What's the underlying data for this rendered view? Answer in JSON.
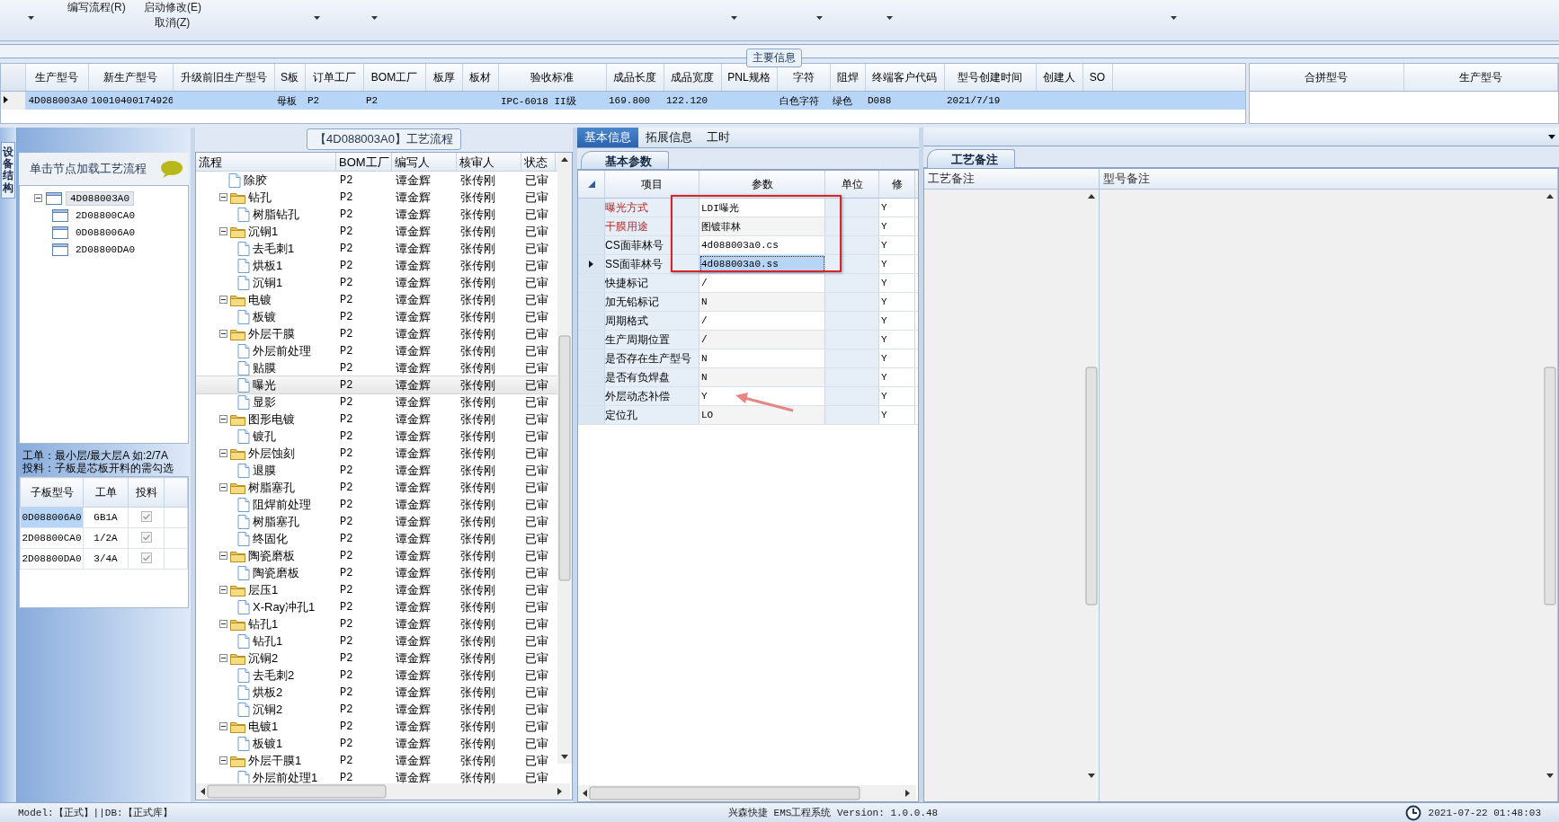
{
  "toolbar": {
    "commands": [
      {
        "label": "编写流程(R)"
      },
      {
        "label": "启动修改(E)"
      },
      {
        "label": "取消(Z)"
      }
    ]
  },
  "main_info": {
    "title": "主要信息",
    "row_selected": true,
    "columns": [
      {
        "label": "生产型号",
        "value": "4D088003A0"
      },
      {
        "label": "新生产型号",
        "value": "10010400174926"
      },
      {
        "label": "升级前旧生产型号"
      },
      {
        "label": "S板",
        "value": "母板"
      },
      {
        "label": "订单工厂",
        "value": "P2"
      },
      {
        "label": "BOM工厂",
        "value": "P2"
      },
      {
        "label": "板厚"
      },
      {
        "label": "板材"
      },
      {
        "label": "验收标准",
        "value": "IPC-6018 II级"
      },
      {
        "label": "成品长度",
        "value": "169.800"
      },
      {
        "label": "成品宽度",
        "value": "122.120"
      },
      {
        "label": "PNL规格"
      },
      {
        "label": "字符",
        "value": "白色字符"
      },
      {
        "label": "阻焊",
        "value": "绿色"
      },
      {
        "label": "终端客户代码",
        "value": "D088"
      },
      {
        "label": "型号创建时间",
        "value": "2021/7/19"
      },
      {
        "label": "创建人"
      },
      {
        "label": "SO"
      }
    ],
    "merge_columns": [
      "合拼型号",
      "生产型号"
    ]
  },
  "structure": {
    "tab": "设备结构",
    "hint": "单击节点加载工艺流程",
    "tree": [
      {
        "label": "4D088003A0",
        "expanded": true,
        "selected": true,
        "children": [
          {
            "label": "2D08800CA0",
            "selected": false
          },
          {
            "label": "0D088006A0",
            "selected": false
          },
          {
            "label": "2D08800DA0",
            "selected": false
          }
        ]
      }
    ],
    "notes": [
      "工单：最小层/最大层A 如:2/7A",
      "投料：子板是芯板开料的需勾选"
    ],
    "columns": [
      "子板型号",
      "工单",
      "投料"
    ],
    "rows": [
      {
        "model": "0D088006A0",
        "order": "GB1A",
        "feed": true,
        "selected": true
      },
      {
        "model": "2D08800CA0",
        "order": "1/2A",
        "feed": true,
        "selected": false
      },
      {
        "model": "2D08800DA0",
        "order": "3/4A",
        "feed": true,
        "selected": false
      }
    ]
  },
  "flow": {
    "title": "【4D088003A0】工艺流程",
    "columns": [
      "流程",
      "BOM工厂",
      "编写人",
      "核审人",
      "状态"
    ],
    "tree": [
      {
        "kind": "continuation",
        "children": [
          {
            "kind": "step",
            "label": "除胶",
            "bom": "P2",
            "writer": "谭金辉",
            "reviewer": "张传刚",
            "status": "已审",
            "selected": false
          }
        ]
      },
      {
        "kind": "group",
        "label": "钻孔",
        "bom": "P2",
        "writer": "谭金辉",
        "reviewer": "张传刚",
        "status": "已审",
        "selected": false,
        "expanded": true,
        "children": [
          {
            "kind": "step",
            "label": "树脂钻孔",
            "bom": "P2",
            "writer": "谭金辉",
            "reviewer": "张传刚",
            "status": "已审",
            "selected": false
          }
        ]
      },
      {
        "kind": "group",
        "label": "沉铜1",
        "bom": "P2",
        "writer": "谭金辉",
        "reviewer": "张传刚",
        "status": "已审",
        "selected": false,
        "expanded": true,
        "children": [
          {
            "kind": "step",
            "label": "去毛刺1",
            "bom": "P2",
            "writer": "谭金辉",
            "reviewer": "张传刚",
            "status": "已审",
            "selected": false
          },
          {
            "kind": "step",
            "label": "烘板1",
            "bom": "P2",
            "writer": "谭金辉",
            "reviewer": "张传刚",
            "status": "已审",
            "selected": false
          },
          {
            "kind": "step",
            "label": "沉铜1",
            "bom": "P2",
            "writer": "谭金辉",
            "reviewer": "张传刚",
            "status": "已审",
            "selected": false
          }
        ]
      },
      {
        "kind": "group",
        "label": "电镀",
        "bom": "P2",
        "writer": "谭金辉",
        "reviewer": "张传刚",
        "status": "已审",
        "selected": false,
        "expanded": true,
        "children": [
          {
            "kind": "step",
            "label": "板镀",
            "bom": "P2",
            "writer": "谭金辉",
            "reviewer": "张传刚",
            "status": "已审",
            "selected": false
          }
        ]
      },
      {
        "kind": "group",
        "label": "外层干膜",
        "bom": "P2",
        "writer": "谭金辉",
        "reviewer": "张传刚",
        "status": "已审",
        "selected": false,
        "expanded": true,
        "children": [
          {
            "kind": "step",
            "label": "外层前处理",
            "bom": "P2",
            "writer": "谭金辉",
            "reviewer": "张传刚",
            "status": "已审",
            "selected": false
          },
          {
            "kind": "step",
            "label": "贴膜",
            "bom": "P2",
            "writer": "谭金辉",
            "reviewer": "张传刚",
            "status": "已审",
            "selected": false
          },
          {
            "kind": "step",
            "label": "曝光",
            "bom": "P2",
            "writer": "谭金辉",
            "reviewer": "张传刚",
            "status": "已审",
            "selected": true
          },
          {
            "kind": "step",
            "label": "显影",
            "bom": "P2",
            "writer": "谭金辉",
            "reviewer": "张传刚",
            "status": "已审",
            "selected": false
          }
        ]
      },
      {
        "kind": "group",
        "label": "图形电镀",
        "bom": "P2",
        "writer": "谭金辉",
        "reviewer": "张传刚",
        "status": "已审",
        "selected": false,
        "expanded": true,
        "children": [
          {
            "kind": "step",
            "label": "镀孔",
            "bom": "P2",
            "writer": "谭金辉",
            "reviewer": "张传刚",
            "status": "已审",
            "selected": false
          }
        ]
      },
      {
        "kind": "group",
        "label": "外层蚀刻",
        "bom": "P2",
        "writer": "谭金辉",
        "reviewer": "张传刚",
        "status": "已审",
        "selected": false,
        "expanded": true,
        "children": [
          {
            "kind": "step",
            "label": "退膜",
            "bom": "P2",
            "writer": "谭金辉",
            "reviewer": "张传刚",
            "status": "已审",
            "selected": false
          }
        ]
      },
      {
        "kind": "group",
        "label": "树脂塞孔",
        "bom": "P2",
        "writer": "谭金辉",
        "reviewer": "张传刚",
        "status": "已审",
        "selected": false,
        "expanded": true,
        "children": [
          {
            "kind": "step",
            "label": "阻焊前处理",
            "bom": "P2",
            "writer": "谭金辉",
            "reviewer": "张传刚",
            "status": "已审",
            "selected": false
          },
          {
            "kind": "step",
            "label": "树脂塞孔",
            "bom": "P2",
            "writer": "谭金辉",
            "reviewer": "张传刚",
            "status": "已审",
            "selected": false
          },
          {
            "kind": "step",
            "label": "终固化",
            "bom": "P2",
            "writer": "谭金辉",
            "reviewer": "张传刚",
            "status": "已审",
            "selected": false
          }
        ]
      },
      {
        "kind": "group",
        "label": "陶瓷磨板",
        "bom": "P2",
        "writer": "谭金辉",
        "reviewer": "张传刚",
        "status": "已审",
        "selected": false,
        "expanded": true,
        "children": [
          {
            "kind": "step",
            "label": "陶瓷磨板",
            "bom": "P2",
            "writer": "谭金辉",
            "reviewer": "张传刚",
            "status": "已审",
            "selected": false
          }
        ]
      },
      {
        "kind": "group",
        "label": "层压1",
        "bom": "P2",
        "writer": "谭金辉",
        "reviewer": "张传刚",
        "status": "已审",
        "selected": false,
        "expanded": true,
        "children": [
          {
            "kind": "step",
            "label": "X-Ray冲孔1",
            "bom": "P2",
            "writer": "谭金辉",
            "reviewer": "张传刚",
            "status": "已审",
            "selected": false
          }
        ]
      },
      {
        "kind": "group",
        "label": "钻孔1",
        "bom": "P2",
        "writer": "谭金辉",
        "reviewer": "张传刚",
        "status": "已审",
        "selected": false,
        "expanded": true,
        "children": [
          {
            "kind": "step",
            "label": "钻孔1",
            "bom": "P2",
            "writer": "谭金辉",
            "reviewer": "张传刚",
            "status": "已审",
            "selected": false
          }
        ]
      },
      {
        "kind": "group",
        "label": "沉铜2",
        "bom": "P2",
        "writer": "谭金辉",
        "reviewer": "张传刚",
        "status": "已审",
        "selected": false,
        "expanded": true,
        "children": [
          {
            "kind": "step",
            "label": "去毛刺2",
            "bom": "P2",
            "writer": "谭金辉",
            "reviewer": "张传刚",
            "status": "已审",
            "selected": false
          },
          {
            "kind": "step",
            "label": "烘板2",
            "bom": "P2",
            "writer": "谭金辉",
            "reviewer": "张传刚",
            "status": "已审",
            "selected": false
          },
          {
            "kind": "step",
            "label": "沉铜2",
            "bom": "P2",
            "writer": "谭金辉",
            "reviewer": "张传刚",
            "status": "已审",
            "selected": false
          }
        ]
      },
      {
        "kind": "group",
        "label": "电镀1",
        "bom": "P2",
        "writer": "谭金辉",
        "reviewer": "张传刚",
        "status": "已审",
        "selected": false,
        "expanded": true,
        "children": [
          {
            "kind": "step",
            "label": "板镀1",
            "bom": "P2",
            "writer": "谭金辉",
            "reviewer": "张传刚",
            "status": "已审",
            "selected": false
          }
        ]
      },
      {
        "kind": "group",
        "label": "外层干膜1",
        "bom": "P2",
        "writer": "谭金辉",
        "reviewer": "张传刚",
        "status": "已审",
        "selected": false,
        "expanded": true,
        "children": [
          {
            "kind": "step",
            "label": "外层前处理1",
            "bom": "P2",
            "writer": "谭金辉",
            "reviewer": "张传刚",
            "status": "已审",
            "selected": false
          }
        ]
      }
    ]
  },
  "detail": {
    "tabs": [
      {
        "label": "基本信息",
        "selected": true
      },
      {
        "label": "拓展信息",
        "selected": false
      },
      {
        "label": "工时",
        "selected": false
      }
    ],
    "subtab": "基本参数",
    "columns": [
      "项目",
      "参数",
      "单位",
      "修"
    ],
    "rows": [
      {
        "item": "曝光方式",
        "value": "LDI曝光",
        "modify": "Y",
        "required": true,
        "current": false
      },
      {
        "item": "干膜用途",
        "value": "图镀菲林",
        "modify": "Y",
        "required": true,
        "current": false
      },
      {
        "item": "CS面菲林号",
        "value": "4d088003a0.cs",
        "modify": "Y",
        "required": false,
        "current": false
      },
      {
        "item": "SS面菲林号",
        "value": "4d088003a0.ss",
        "modify": "Y",
        "required": false,
        "current": true
      },
      {
        "item": "快捷标记",
        "value": "/",
        "modify": "Y",
        "required": false,
        "current": false
      },
      {
        "item": "加无铅标记",
        "value": "N",
        "modify": "Y",
        "required": false,
        "current": false
      },
      {
        "item": "周期格式",
        "value": "/",
        "modify": "Y",
        "required": false,
        "current": false
      },
      {
        "item": "生产周期位置",
        "value": "/",
        "modify": "Y",
        "required": false,
        "current": false
      },
      {
        "item": "是否存在生产型号",
        "value": "N",
        "modify": "Y",
        "required": false,
        "current": false
      },
      {
        "item": "是否有负焊盘",
        "value": "N",
        "modify": "Y",
        "required": false,
        "current": false
      },
      {
        "item": "外层动态补偿",
        "value": "Y",
        "modify": "Y",
        "required": false,
        "current": false
      },
      {
        "item": "定位孔",
        "value": "LO",
        "modify": "Y",
        "required": false,
        "current": false
      }
    ]
  },
  "remarks": {
    "tab": "工艺备注",
    "columns": [
      "工艺备注",
      "型号备注"
    ]
  },
  "status_bar": {
    "mode": "Model:【正式】||DB:【正式库】",
    "app": "兴森快捷 EMS工程系统 Version: 1.0.0.48",
    "time": "2021-07-22 01:48:03"
  }
}
